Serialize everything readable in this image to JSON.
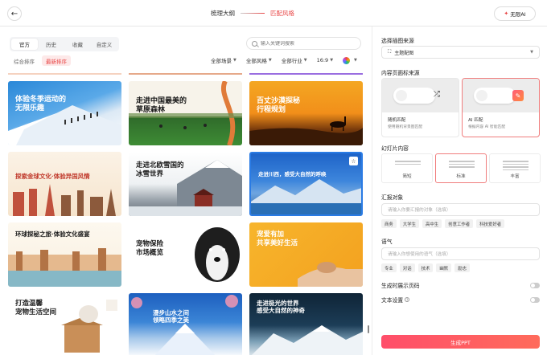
{
  "header": {
    "step1": "梳理大纲",
    "step2": "匹配风格",
    "nolimit": "无限AI"
  },
  "tabs": [
    "官方",
    "历史",
    "收藏",
    "自定义"
  ],
  "search": {
    "placeholder": "输入关键词搜索"
  },
  "sort": [
    "综合排序",
    "最新排序"
  ],
  "filters": [
    "全部场景",
    "全部风格",
    "全部行业",
    "16:9"
  ],
  "cards": [
    {
      "title": "体验冬季运动的\n无限乐趣"
    },
    {
      "title": "走进中国最美的\n草原森林"
    },
    {
      "title": "百丈沙漠探秘\n行程规划"
    },
    {
      "title": "探索金球文化·体验异国风情"
    },
    {
      "title": "走进北欧雪国的\n冰雪世界"
    },
    {
      "title": "走进川西，感受大自然的呼唤"
    },
    {
      "title": "环球探秘之旅·体验文化盛宴"
    },
    {
      "title": "宠物保险\n市场概览"
    },
    {
      "title": "宠爱有加\n共享美好生活"
    },
    {
      "title": "打造温馨\n宠物生活空间"
    },
    {
      "title": "漫步山水之间\n领略四季之美"
    },
    {
      "title": "走进极光的世界\n感受大自然的神奇"
    }
  ],
  "right": {
    "source_title": "选择插图来源",
    "source_value": "主题配图",
    "bg_title": "内容页面标来源",
    "bg_options": [
      {
        "label": "随机匹配",
        "desc": "使用随机背景图匹配"
      },
      {
        "label": "AI 匹配",
        "desc": "根据内容 AI 智能匹配"
      }
    ],
    "slide_title": "幻灯片内容",
    "amounts": [
      "简短",
      "标准",
      "丰富"
    ],
    "audience_title": "汇报对象",
    "audience_placeholder": "请输入你要汇报的对象（选填）",
    "audience_chips": [
      "商务",
      "大学生",
      "高中生",
      "创意工作者",
      "科技爱好者"
    ],
    "tone_title": "语气",
    "tone_placeholder": "请输入你想使用的语气（选填）",
    "tone_chips": [
      "专业",
      "对话",
      "技术",
      "幽默",
      "励志"
    ],
    "page_numbers": "生成时展示页码",
    "text_settings": "文本设置",
    "generate": "生成PPT"
  }
}
